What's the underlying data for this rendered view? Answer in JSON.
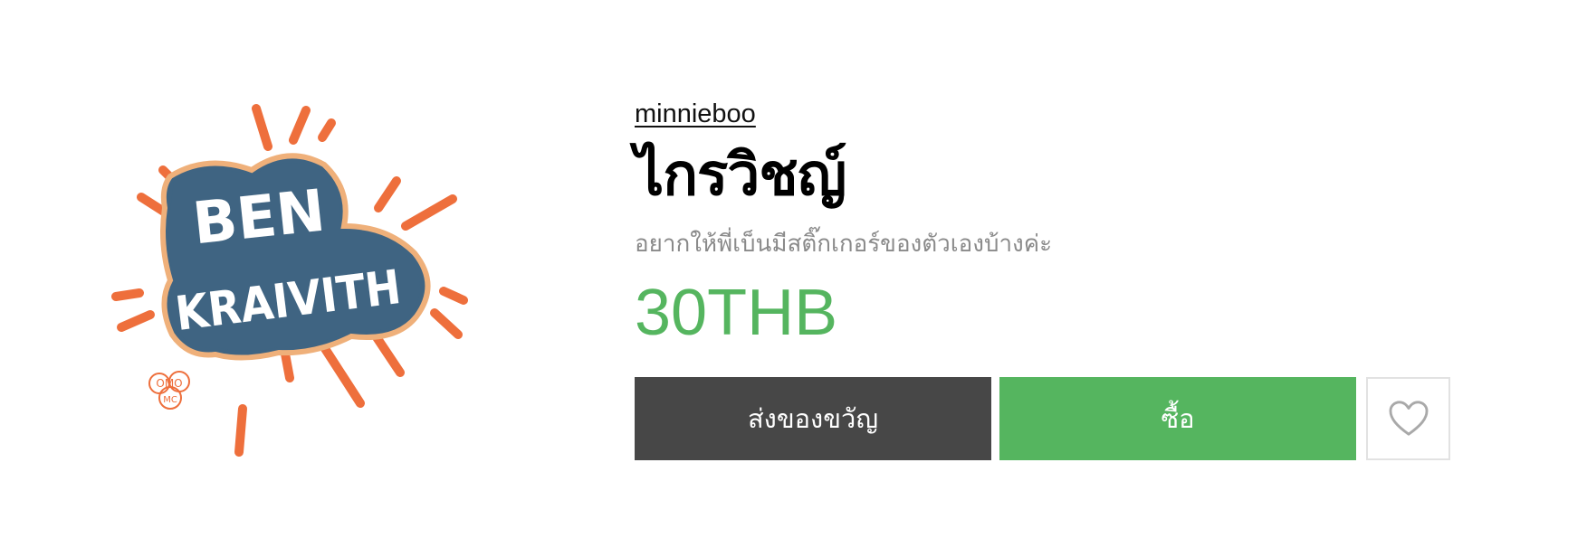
{
  "product": {
    "author": "minnieboo",
    "title": "ไกรวิชญ์",
    "description": "อยากให้พี่เบ็นมีสติ๊กเกอร์ของตัวเองบ้างค่ะ",
    "price": "30THB",
    "image_text": {
      "line1": "BEN",
      "line2": "KRAIVITH",
      "stamp_top": "OMO",
      "stamp_bottom": "MC"
    }
  },
  "actions": {
    "gift_label": "ส่งของขวัญ",
    "buy_label": "ซื้อ",
    "favorite_icon": "heart-outline-icon"
  },
  "colors": {
    "price": "#55b55f",
    "buy_button": "#55b55f",
    "gift_button": "#474747",
    "logo_blue": "#3f6482",
    "logo_orange": "#ee6f3c"
  }
}
